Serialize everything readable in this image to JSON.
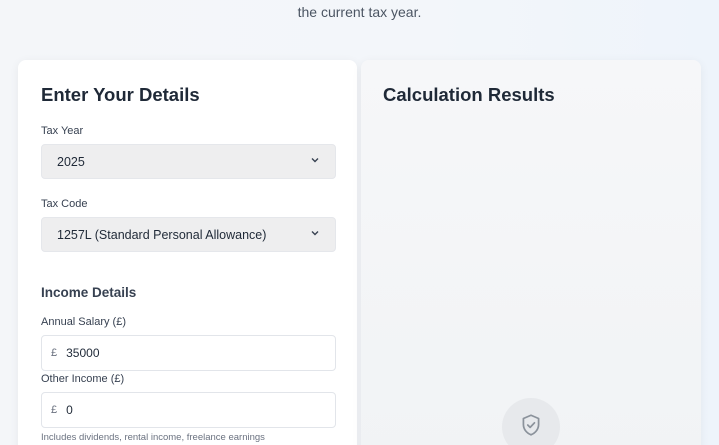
{
  "intro": {
    "line2": "the current tax year."
  },
  "details": {
    "title": "Enter Your Details",
    "tax_year_label": "Tax Year",
    "tax_year_value": "2025",
    "tax_code_label": "Tax Code",
    "tax_code_value": "1257L (Standard Personal Allowance)",
    "income_section_title": "Income Details",
    "salary_label": "Annual Salary (£)",
    "salary_currency": "£",
    "salary_value": "35000",
    "other_income_label": "Other Income (£)",
    "other_income_currency": "£",
    "other_income_value": "0",
    "other_income_hint": "Includes dividends, rental income, freelance earnings"
  },
  "results": {
    "title": "Calculation Results",
    "icon": "shield-check-icon"
  }
}
